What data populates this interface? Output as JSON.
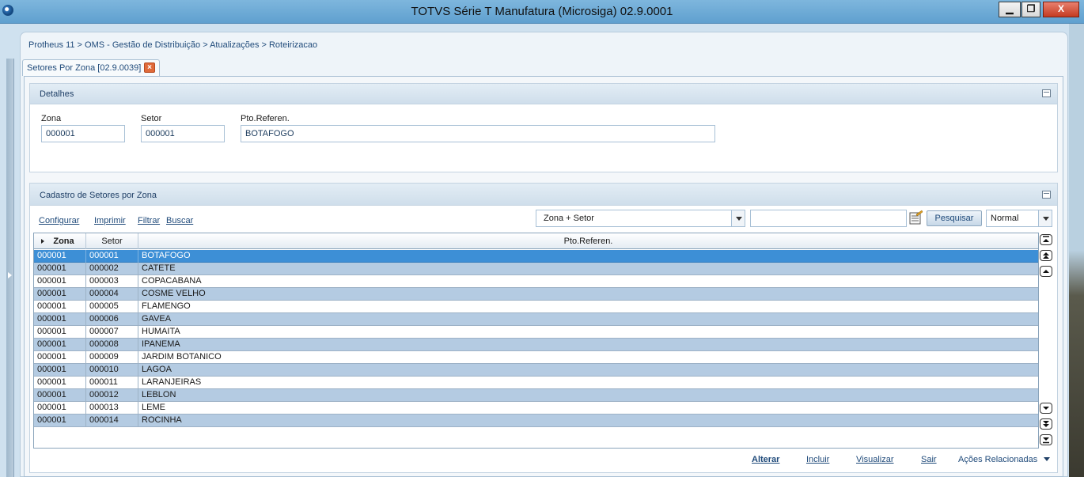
{
  "window": {
    "title": "TOTVS Série T Manufatura (Microsiga) 02.9.0001",
    "minimize": "▁",
    "maximize": "❐",
    "close": "X"
  },
  "breadcrumb": "Protheus 11 > OMS - Gestão de Distribuição > Atualizações > Roteirizacao",
  "tab": {
    "label": "Setores Por Zona [02.9.0039]",
    "close": "×"
  },
  "details": {
    "title": "Detalhes",
    "fields": {
      "zona": {
        "label": "Zona",
        "value": "000001"
      },
      "setor": {
        "label": "Setor",
        "value": "000001"
      },
      "pto": {
        "label": "Pto.Referen.",
        "value": "BOTAFOGO"
      }
    }
  },
  "registry": {
    "title": "Cadastro de Setores por Zona",
    "toolbar": {
      "configurar": "Configurar",
      "imprimir": "Imprimir",
      "filtrar": "Filtrar",
      "buscar": "Buscar"
    },
    "search": {
      "index_selected": "Zona + Setor",
      "query": "",
      "button": "Pesquisar",
      "mode": "Normal"
    },
    "columns": [
      "Zona",
      "Setor",
      "Pto.Referen."
    ],
    "selected_row": 0,
    "rows": [
      {
        "zona": "000001",
        "setor": "000001",
        "pto": "BOTAFOGO"
      },
      {
        "zona": "000001",
        "setor": "000002",
        "pto": "CATETE"
      },
      {
        "zona": "000001",
        "setor": "000003",
        "pto": "COPACABANA"
      },
      {
        "zona": "000001",
        "setor": "000004",
        "pto": "COSME VELHO"
      },
      {
        "zona": "000001",
        "setor": "000005",
        "pto": "FLAMENGO"
      },
      {
        "zona": "000001",
        "setor": "000006",
        "pto": "GAVEA"
      },
      {
        "zona": "000001",
        "setor": "000007",
        "pto": "HUMAITA"
      },
      {
        "zona": "000001",
        "setor": "000008",
        "pto": "IPANEMA"
      },
      {
        "zona": "000001",
        "setor": "000009",
        "pto": "JARDIM BOTANICO"
      },
      {
        "zona": "000001",
        "setor": "000010",
        "pto": "LAGOA"
      },
      {
        "zona": "000001",
        "setor": "000011",
        "pto": "LARANJEIRAS"
      },
      {
        "zona": "000001",
        "setor": "000012",
        "pto": "LEBLON"
      },
      {
        "zona": "000001",
        "setor": "000013",
        "pto": "LEME"
      },
      {
        "zona": "000001",
        "setor": "000014",
        "pto": "ROCINHA"
      }
    ]
  },
  "actions": {
    "alterar": "Alterar",
    "incluir": "Incluir",
    "visualizar": "Visualizar",
    "sair": "Sair",
    "relacionadas": "Ações Relacionadas"
  },
  "colors": {
    "selected_row": "#3d8fd6",
    "alt_row": "#b4cbe2",
    "link": "#1f4a7a",
    "title_bar": "#6aa8d5"
  }
}
